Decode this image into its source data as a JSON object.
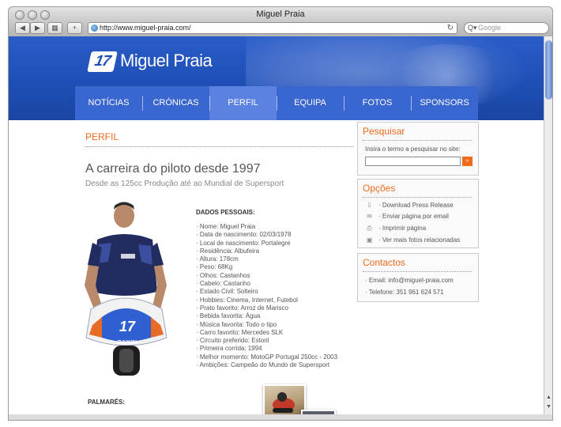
{
  "browser": {
    "window_title": "Miguel Praia",
    "url": "http://www.miguel-praia.com/",
    "search_placeholder": "Google",
    "back_icon": "◀",
    "forward_icon": "▶",
    "grid_icon": "▦",
    "add_icon": "+",
    "reload_icon": "↻",
    "search_icon": "Q▾"
  },
  "site": {
    "logo_number": "17",
    "logo_text": "Miguel Praia",
    "nav": [
      "NOTÍCIAS",
      "CRÓNICAS",
      "PERFIL",
      "EQUIPA",
      "FOTOS",
      "SPONSORS"
    ],
    "active_nav": "PERFIL",
    "accent_color": "#f06a1c",
    "header_color": "#1f4fb6"
  },
  "main": {
    "section_title": "PERFIL",
    "headline": "A carreira do piloto desde 1997",
    "subheadline": "Desde as 125cc Produção até ao Mundial de Supersport",
    "personal_title": "DADOS PESSOAIS:",
    "facts": [
      "· Nome: Miguel Praia",
      "· Data de nascimento: 02/03/1978",
      "· Local de nascimento: Portalegre",
      "· Residência: Albufeira",
      "· Altura: 178cm",
      "· Peso: 68Kg",
      "· Olhos: Castanhos",
      "· Cabelo: Castanho",
      "· Estado Civil: Solteiro",
      "· Hobbies: Cinema, Internet, Futebol",
      "· Prato favorito: Arroz de Marisco",
      "· Bebida favorita: Água",
      "· Música favorita: Todo o tipo",
      "· Carro favorito: Mercedes SLK",
      "· Circuito preferido: Estoril",
      "· Primeira corrida: 1994",
      "· Melhor momento: MotoGP Portugal 250cc - 2003",
      "· Ambições: Campeão do Mundo de Supersport"
    ],
    "palmares_title": "PALMARÉS:",
    "bike_number": "17",
    "bike_sponsor": "DAIKIN"
  },
  "sidebar": {
    "search": {
      "title": "Pesquisar",
      "label": "Insira o termo a pesquisar no site:",
      "go_icon": "»"
    },
    "options": {
      "title": "Opções",
      "items": [
        {
          "icon": "⇩",
          "label": "· Download Press Release"
        },
        {
          "icon": "✉",
          "label": "· Enviar página  por email"
        },
        {
          "icon": "⎙",
          "label": "· Imprimir página"
        },
        {
          "icon": "▣",
          "label": "· Ver mais fotos relacionadas"
        }
      ]
    },
    "contacts": {
      "title": "Contactos",
      "email": "· Email: info@miguel-praia.com",
      "phone": "· Telefone: 351 961 624 571"
    }
  }
}
